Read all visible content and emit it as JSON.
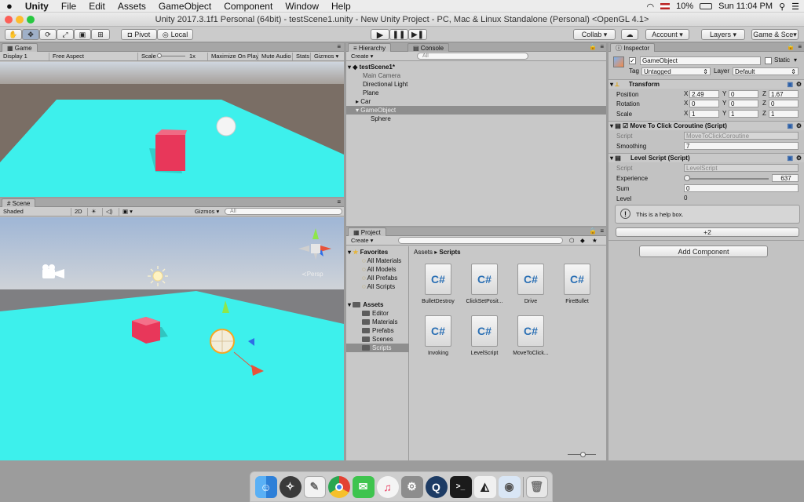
{
  "menubar": {
    "apple": "",
    "items": [
      "Unity",
      "File",
      "Edit",
      "Assets",
      "GameObject",
      "Component",
      "Window",
      "Help"
    ],
    "battery": "10%",
    "clock": "Sun 11:04 PM"
  },
  "window": {
    "title": "Unity 2017.3.1f1 Personal (64bit) - testScene1.unity - New Unity Project - PC, Mac & Linux Standalone (Personal) <OpenGL 4.1>"
  },
  "toolbar": {
    "pivot": "Pivot",
    "local": "Local",
    "collab": "Collab ▾",
    "account": "Account ▾",
    "layers": "Layers ▾",
    "layout": "Game & Sce▾"
  },
  "game": {
    "tab": "Game",
    "display": "Display 1",
    "aspect": "Free Aspect",
    "scale_label": "Scale",
    "scale_value": "1x",
    "maximize": "Maximize On Play",
    "mute": "Mute Audio",
    "stats": "Stats",
    "gizmos": "Gizmos ▾"
  },
  "scene": {
    "tab": "Scene",
    "shading": "Shaded",
    "mode2d": "2D",
    "gizmos": "Gizmos ▾",
    "search": "All",
    "persp": "≺Persp"
  },
  "hierarchy": {
    "tab": "Hierarchy",
    "console_tab": "Console",
    "create": "Create ▾",
    "search": "All",
    "scene": "testScene1*",
    "items": [
      "Main Camera",
      "Directional Light",
      "Plane",
      "Car",
      "GameObject",
      "Sphere"
    ]
  },
  "project": {
    "tab": "Project",
    "create": "Create ▾",
    "favorites": "Favorites",
    "fav_items": [
      "All Materials",
      "All Models",
      "All Prefabs",
      "All Scripts"
    ],
    "assets": "Assets",
    "asset_folders": [
      "Editor",
      "Materials",
      "Prefabs",
      "Scenes",
      "Scripts"
    ],
    "breadcrumb": [
      "Assets",
      "Scripts"
    ],
    "files": [
      "BulletDestroy",
      "ClickSetPosit...",
      "Drive",
      "FireBullet",
      "Invoking",
      "LevelScript",
      "MoveToClick..."
    ]
  },
  "inspector": {
    "tab": "Inspector",
    "object_name": "GameObject",
    "static": "Static",
    "tag_label": "Tag",
    "tag": "Untagged",
    "layer_label": "Layer",
    "layer": "Default",
    "transform": {
      "title": "Transform",
      "position": "Position",
      "rotation": "Rotation",
      "scale": "Scale",
      "pos": [
        "2.49",
        "0",
        "1.67"
      ],
      "rot": [
        "0",
        "0",
        "0"
      ],
      "scl": [
        "1",
        "1",
        "1"
      ]
    },
    "move": {
      "title": "Move To Click Coroutine (Script)",
      "script_label": "Script",
      "script": "MoveToClickCoroutine",
      "smoothing_label": "Smoothing",
      "smoothing": "7"
    },
    "level": {
      "title": "Level Script (Script)",
      "script_label": "Script",
      "script": "LevelScript",
      "exp_label": "Experience",
      "exp": "637",
      "exp_fraction": 0.04,
      "sum_label": "Sum",
      "sum": "0",
      "level_label": "Level",
      "level": "0",
      "help": "This is a help box.",
      "button": "+2"
    },
    "add_component": "Add Component"
  }
}
